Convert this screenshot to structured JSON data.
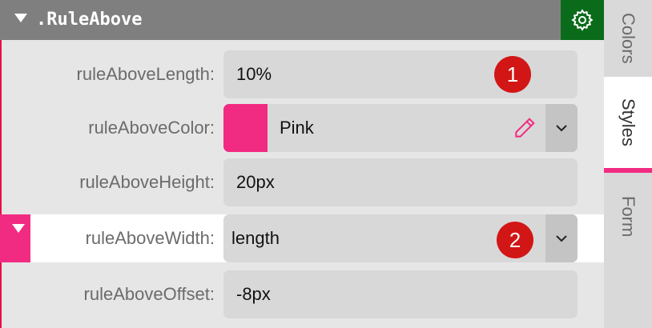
{
  "section": {
    "title": ".RuleAbove"
  },
  "fields": [
    {
      "label": "ruleAboveLength:",
      "value": "10%"
    },
    {
      "label": "ruleAboveColor:",
      "value": "Pink"
    },
    {
      "label": "ruleAboveHeight:",
      "value": "20px"
    },
    {
      "label": "ruleAboveWidth:",
      "value": "length"
    },
    {
      "label": "ruleAboveOffset:",
      "value": "-8px"
    }
  ],
  "badges": [
    "1",
    "2"
  ],
  "tabs": [
    {
      "label": "Colors",
      "active": false
    },
    {
      "label": "Styles",
      "active": true
    },
    {
      "label": "Form",
      "active": false
    }
  ],
  "colors": {
    "header": "#7f7f7f",
    "gear_button": "#0a6b1a",
    "accent_pink": "#f22b82",
    "badge_red": "#d21616"
  },
  "icons": [
    "collapse-triangle-icon",
    "gear-icon",
    "pencil-icon",
    "chevron-down-icon"
  ]
}
